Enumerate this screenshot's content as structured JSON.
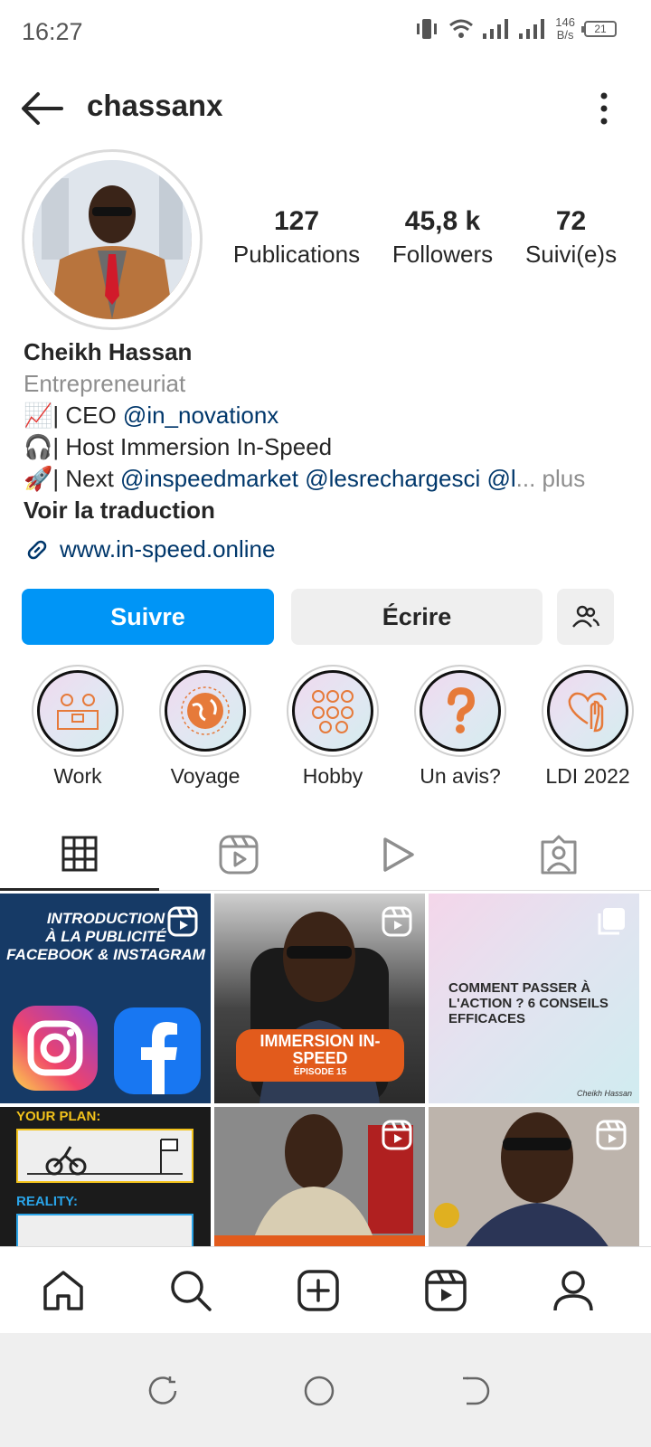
{
  "status_bar": {
    "time": "16:27",
    "speed_value": "146",
    "speed_unit": "B/s",
    "battery": "21"
  },
  "header": {
    "username": "chassanx",
    "icons": {
      "back": "arrow-left-icon",
      "menu": "more-vertical-icon"
    }
  },
  "profile": {
    "stats": [
      {
        "value": "127",
        "label": "Publications"
      },
      {
        "value": "45,8 k",
        "label": "Followers"
      },
      {
        "value": "72",
        "label": "Suivi(e)s"
      }
    ],
    "name": "Cheikh Hassan",
    "category": "Entrepreneuriat",
    "bio": {
      "line1_emoji": "📈",
      "line1_prefix": "| CEO ",
      "line1_mention": "@in_novationx",
      "line2_emoji": "🎧",
      "line2_text": "| Host Immersion In-Speed",
      "line3_emoji": "🚀",
      "line3_prefix": "| Next ",
      "line3_mention1": "@inspeedmarket",
      "line3_mention2": "@lesrechargesci",
      "line3_mention3": "@l",
      "line3_more": "... plus"
    },
    "translate": "Voir la traduction",
    "website": "www.in-speed.online"
  },
  "actions": {
    "follow": "Suivre",
    "message": "Écrire",
    "suggest_icon": "add-people-icon"
  },
  "highlights": [
    {
      "label": "Work",
      "icon": "workspace-icon"
    },
    {
      "label": "Voyage",
      "icon": "globe-icon"
    },
    {
      "label": "Hobby",
      "icon": "sports-balls-icon"
    },
    {
      "label": "Un avis?",
      "icon": "question-icon"
    },
    {
      "label": "LDI 2022",
      "icon": "heart-hand-icon"
    }
  ],
  "tabs": [
    {
      "icon": "grid-icon",
      "active": true
    },
    {
      "icon": "reels-icon"
    },
    {
      "icon": "video-play-icon"
    },
    {
      "icon": "tagged-icon"
    }
  ],
  "posts": {
    "p1_title_a": "INTRODUCTION",
    "p1_title_b": "À LA PUBLICITÉ",
    "p1_title_c": "FACEBOOK & INSTAGRAM",
    "p2_title": "IMMERSION IN-SPEED",
    "p2_episode": "ÉPISODE 15",
    "p3_title": "COMMENT PASSER À L'ACTION ? 6 CONSEILS EFFICACES",
    "p3_sign": "Cheikh Hassan",
    "p4_plan": "YOUR PLAN:",
    "p4_reality": "REALITY:"
  },
  "bottom_nav": [
    "home-icon",
    "search-icon",
    "create-post-icon",
    "reels-icon",
    "profile-icon"
  ],
  "system_nav": [
    "recent-apps-icon",
    "home-circle-icon",
    "back-icon"
  ],
  "colors": {
    "accent": "#0095f6",
    "link": "#00376b",
    "orange": "#e25b1c"
  }
}
